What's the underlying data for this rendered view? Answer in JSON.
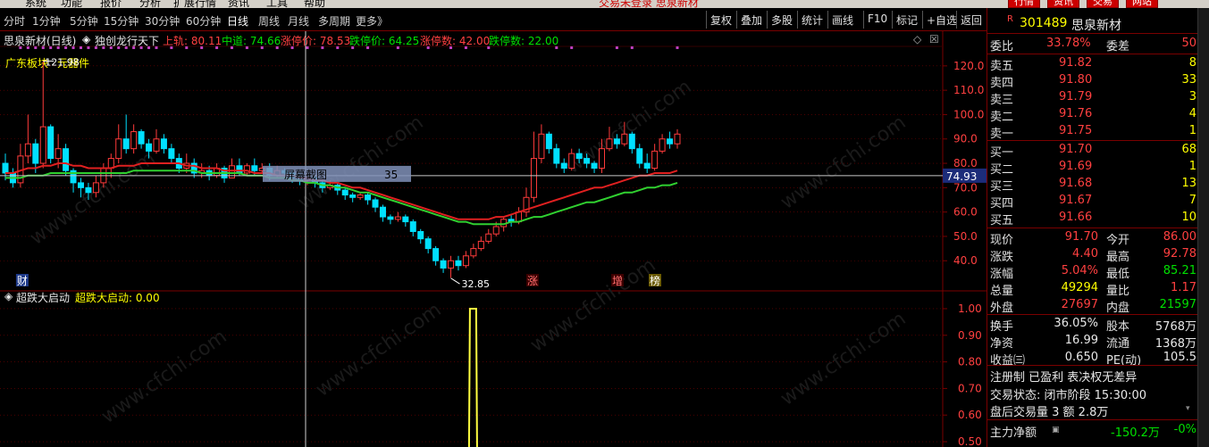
{
  "menubar": {
    "items": [
      "系统",
      "功能",
      "报价",
      "分析",
      "扩展行情",
      "资讯",
      "工具",
      "帮助"
    ],
    "center_title": "交易未登录 思泉新材",
    "right_buttons": [
      "行情",
      "资讯",
      "交易",
      "网站"
    ]
  },
  "toolbar": {
    "periods": [
      "分时",
      "1分钟",
      "5分钟",
      "15分钟",
      "30分钟",
      "60分钟",
      "日线",
      "周线",
      "月线",
      "多周期",
      "更多》"
    ],
    "active_period": "日线",
    "buttons": [
      "复权",
      "叠加",
      "多股",
      "统计",
      "画线",
      "F10",
      "标记",
      "+自选",
      "返回"
    ]
  },
  "chart_header": {
    "stock_label": "思泉新材(日线)",
    "indicator": "独创龙行天下",
    "up_label": "上轨: 80.11",
    "mid_label": "中道: 74.66",
    "limit_up_price": "涨停价: 78.53",
    "limit_down_price": "跌停价: 64.25",
    "limit_up_count": "涨停数: 42.00",
    "limit_down_count": "跌停数: 22.00",
    "sector": "广东板块",
    "concept": "元器件",
    "high_mark": "121.98",
    "low_mark": "32.85",
    "current_price_tag": "74.93",
    "screenshot_label": "屏幕截图",
    "screenshot_value": "35",
    "badge_cai": "财",
    "badge_zhang": "涨",
    "badge_zeng": "增",
    "badge_bang": "榜"
  },
  "sub_header": {
    "name": "超跌大启动",
    "value_label": "超跌大启动: 0.00"
  },
  "watermark": "www.cfchi.com",
  "colors": {
    "up": "#ff3b3b",
    "down": "#00e0ff",
    "ma_red": "#e02020",
    "ma_green": "#30d030",
    "grid": "#7a0000",
    "signal": "#ffff40"
  },
  "chart_data": [
    {
      "type": "candlestick",
      "title": "思泉新材(日线)",
      "y_ticks": [
        120.0,
        110.0,
        100.0,
        90.0,
        80.0,
        70.0,
        60.0,
        50.0,
        40.0
      ],
      "ylim": [
        28,
        128
      ],
      "candles": [
        [
          80,
          76,
          84,
          73
        ],
        [
          76,
          72,
          78,
          70
        ],
        [
          72,
          83,
          88,
          70
        ],
        [
          83,
          88,
          100,
          80
        ],
        [
          88,
          80,
          90,
          76
        ],
        [
          80,
          95,
          122,
          78
        ],
        [
          95,
          82,
          96,
          80
        ],
        [
          82,
          86,
          92,
          78
        ],
        [
          86,
          77,
          88,
          75
        ],
        [
          77,
          72,
          78,
          68
        ],
        [
          72,
          70,
          74,
          66
        ],
        [
          70,
          68,
          72,
          65
        ],
        [
          68,
          72,
          75,
          66
        ],
        [
          72,
          78,
          80,
          70
        ],
        [
          78,
          82,
          84,
          74
        ],
        [
          82,
          90,
          96,
          80
        ],
        [
          90,
          86,
          100,
          84
        ],
        [
          86,
          93,
          96,
          84
        ],
        [
          93,
          88,
          94,
          86
        ],
        [
          88,
          85,
          90,
          82
        ],
        [
          85,
          90,
          94,
          84
        ],
        [
          90,
          86,
          92,
          84
        ],
        [
          86,
          82,
          88,
          80
        ],
        [
          82,
          78,
          84,
          76
        ],
        [
          78,
          80,
          84,
          76
        ],
        [
          80,
          76,
          82,
          74
        ],
        [
          76,
          77,
          80,
          74
        ],
        [
          77,
          75,
          79,
          73
        ],
        [
          75,
          78,
          80,
          74
        ],
        [
          78,
          74,
          79,
          72
        ],
        [
          74,
          79,
          82,
          74
        ],
        [
          79,
          76,
          82,
          75
        ],
        [
          76,
          79,
          80,
          75
        ],
        [
          79,
          77,
          82,
          75
        ],
        [
          77,
          78,
          80,
          76
        ],
        [
          78,
          75,
          80,
          73
        ],
        [
          75,
          77,
          79,
          74
        ],
        [
          77,
          76,
          78,
          74
        ],
        [
          76,
          74,
          77,
          72
        ],
        [
          74,
          73,
          76,
          71
        ],
        [
          73,
          74,
          76,
          71
        ],
        [
          74,
          72,
          75,
          70
        ],
        [
          72,
          70,
          73,
          68
        ],
        [
          70,
          71,
          73,
          69
        ],
        [
          71,
          69,
          72,
          67
        ],
        [
          69,
          67,
          70,
          65
        ],
        [
          67,
          66,
          68,
          64
        ],
        [
          66,
          67,
          68,
          65
        ],
        [
          67,
          65,
          68,
          63
        ],
        [
          65,
          62,
          66,
          60
        ],
        [
          62,
          58,
          63,
          56
        ],
        [
          58,
          57,
          59,
          55
        ],
        [
          57,
          58,
          60,
          56
        ],
        [
          58,
          56,
          59,
          54
        ],
        [
          56,
          52,
          57,
          50
        ],
        [
          52,
          49,
          53,
          47
        ],
        [
          49,
          45,
          50,
          43
        ],
        [
          45,
          40,
          46,
          38
        ],
        [
          40,
          37,
          41,
          35
        ],
        [
          37,
          40,
          42,
          33
        ],
        [
          40,
          38,
          42,
          36
        ],
        [
          38,
          42,
          44,
          37
        ],
        [
          42,
          45,
          47,
          41
        ],
        [
          45,
          48,
          50,
          44
        ],
        [
          48,
          51,
          53,
          47
        ],
        [
          51,
          54,
          56,
          50
        ],
        [
          54,
          57,
          58,
          52
        ],
        [
          57,
          56,
          59,
          54
        ],
        [
          56,
          60,
          62,
          55
        ],
        [
          60,
          66,
          70,
          58
        ],
        [
          66,
          82,
          93,
          64
        ],
        [
          82,
          92,
          96,
          80
        ],
        [
          92,
          86,
          93,
          84
        ],
        [
          86,
          80,
          88,
          78
        ],
        [
          80,
          78,
          82,
          76
        ],
        [
          78,
          84,
          86,
          77
        ],
        [
          84,
          82,
          86,
          80
        ],
        [
          82,
          80,
          84,
          78
        ],
        [
          80,
          78,
          81,
          76
        ],
        [
          78,
          86,
          90,
          76
        ],
        [
          86,
          90,
          95,
          85
        ],
        [
          90,
          88,
          92,
          86
        ],
        [
          88,
          92,
          97,
          87
        ],
        [
          92,
          86,
          93,
          84
        ],
        [
          86,
          80,
          88,
          78
        ],
        [
          80,
          78,
          84,
          76
        ],
        [
          78,
          85,
          88,
          77
        ],
        [
          85,
          90,
          92,
          84
        ],
        [
          90,
          88,
          93,
          86
        ],
        [
          88,
          92,
          94,
          86
        ]
      ],
      "ma_red": [
        76,
        76,
        77,
        78,
        78,
        79,
        79,
        80,
        80,
        79,
        79,
        78,
        78,
        78,
        78,
        79,
        79,
        79,
        80,
        80,
        80,
        80,
        80,
        80,
        79,
        79,
        78,
        78,
        78,
        77,
        77,
        77,
        77,
        76,
        76,
        76,
        75,
        75,
        75,
        74,
        74,
        73,
        73,
        72,
        72,
        71,
        70,
        70,
        69,
        68,
        67,
        66,
        65,
        64,
        63,
        62,
        61,
        60,
        59,
        58,
        57,
        57,
        57,
        57,
        57,
        58,
        58,
        59,
        60,
        61,
        62,
        63,
        64,
        65,
        66,
        67,
        68,
        69,
        70,
        70,
        71,
        72,
        73,
        74,
        75,
        75,
        76,
        76,
        76,
        77
      ],
      "ma_green": [
        74,
        74,
        74,
        75,
        75,
        75,
        76,
        76,
        76,
        76,
        76,
        76,
        76,
        76,
        76,
        76,
        76,
        77,
        77,
        77,
        77,
        77,
        77,
        77,
        77,
        77,
        76,
        76,
        76,
        76,
        76,
        76,
        75,
        75,
        75,
        74,
        74,
        74,
        73,
        73,
        72,
        72,
        71,
        71,
        70,
        70,
        69,
        68,
        68,
        67,
        66,
        65,
        64,
        63,
        62,
        61,
        60,
        59,
        58,
        57,
        56,
        56,
        55,
        55,
        55,
        55,
        55,
        56,
        56,
        57,
        58,
        58,
        59,
        60,
        61,
        62,
        63,
        64,
        64,
        65,
        66,
        67,
        68,
        68,
        69,
        70,
        70,
        71,
        71,
        72
      ]
    },
    {
      "type": "line",
      "title": "超跌大启动",
      "y_ticks": [
        1.0,
        0.9,
        0.8,
        0.7,
        0.6,
        0.5
      ],
      "ylim": [
        0.48,
        1.02
      ],
      "signal_spike": {
        "x_index": 62,
        "value": 1.0
      }
    }
  ],
  "quote_panel": {
    "code": "301489",
    "name": "思泉新材",
    "marker": "R",
    "weibi_label": "委比",
    "weibi": "33.78%",
    "weicha_label": "委差",
    "weicha": "50",
    "sell": [
      {
        "label": "卖五",
        "price": "91.82",
        "vol": "8"
      },
      {
        "label": "卖四",
        "price": "91.80",
        "vol": "33"
      },
      {
        "label": "卖三",
        "price": "91.79",
        "vol": "3"
      },
      {
        "label": "卖二",
        "price": "91.76",
        "vol": "4"
      },
      {
        "label": "卖一",
        "price": "91.75",
        "vol": "1"
      }
    ],
    "buy": [
      {
        "label": "买一",
        "price": "91.70",
        "vol": "68"
      },
      {
        "label": "买二",
        "price": "91.69",
        "vol": "1"
      },
      {
        "label": "买三",
        "price": "91.68",
        "vol": "13"
      },
      {
        "label": "买四",
        "price": "91.67",
        "vol": "7"
      },
      {
        "label": "买五",
        "price": "91.66",
        "vol": "10"
      }
    ],
    "stats1": [
      {
        "l1": "现价",
        "v1": "91.70",
        "l2": "今开",
        "v2": "86.00"
      },
      {
        "l1": "涨跌",
        "v1": "4.40",
        "l2": "最高",
        "v2": "92.78"
      },
      {
        "l1": "涨幅",
        "v1": "5.04%",
        "l2": "最低",
        "v2": "85.21"
      },
      {
        "l1": "总量",
        "v1": "49294",
        "l2": "量比",
        "v2": "1.17"
      },
      {
        "l1": "外盘",
        "v1": "27697",
        "l2": "内盘",
        "v2": "21597"
      }
    ],
    "stats2": [
      {
        "l1": "换手",
        "v1": "36.05%",
        "l2": "股本",
        "v2": "5768万"
      },
      {
        "l1": "净资",
        "v1": "16.99",
        "l2": "流通",
        "v2": "1368万"
      },
      {
        "l1": "收益㈢",
        "v1": "0.650",
        "l2": "PE(动)",
        "v2": "105.5"
      }
    ],
    "notice": "注册制 已盈利 表决权无差异",
    "trade_status": "交易状态: 闭市阶段 15:30:00",
    "after_hours": "盘后交易量 3 额 2.8万",
    "net_label": "主力净额",
    "net_value": "-150.2万",
    "net_pct": "-0%"
  }
}
